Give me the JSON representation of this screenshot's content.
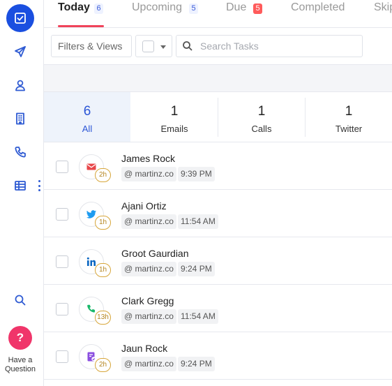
{
  "tabs": [
    {
      "label": "Today",
      "count": "6"
    },
    {
      "label": "Upcoming",
      "count": "5"
    },
    {
      "label": "Due",
      "count": "5"
    },
    {
      "label": "Completed"
    },
    {
      "label": "Skip"
    }
  ],
  "toolbar": {
    "filters_label": "Filters & Views",
    "search_placeholder": "Search Tasks"
  },
  "stats": [
    {
      "value": "6",
      "label": "All"
    },
    {
      "value": "1",
      "label": "Emails"
    },
    {
      "value": "1",
      "label": "Calls"
    },
    {
      "value": "1",
      "label": "Twitter"
    }
  ],
  "tasks": [
    {
      "name": "James Rock",
      "company": "@ martinz.co",
      "time": "9:39 PM",
      "age": "2h",
      "type": "email"
    },
    {
      "name": "Ajani Ortiz",
      "company": "@ martinz.co",
      "time": "11:54 AM",
      "age": "1h",
      "type": "twitter"
    },
    {
      "name": "Groot Gaurdian",
      "company": "@ martinz.co",
      "time": "9:24 PM",
      "age": "1h",
      "type": "linkedin"
    },
    {
      "name": "Clark Gregg",
      "company": "@ martinz.co",
      "time": "11:54 AM",
      "age": "13h",
      "type": "call"
    },
    {
      "name": "Jaun Rock",
      "company": "@ martinz.co",
      "time": "9:24 PM",
      "age": "2h",
      "type": "task"
    }
  ],
  "help": {
    "icon": "?",
    "label": "Have a Question"
  },
  "colors": {
    "accent": "#1a4fe0",
    "tab_underline": "#f0435a",
    "help": "#f0356a",
    "age_badge": "#d7a63a"
  },
  "icons": [
    "tasks-icon",
    "send-icon",
    "contacts-icon",
    "company-icon",
    "phone-icon",
    "table-icon",
    "search-icon"
  ]
}
